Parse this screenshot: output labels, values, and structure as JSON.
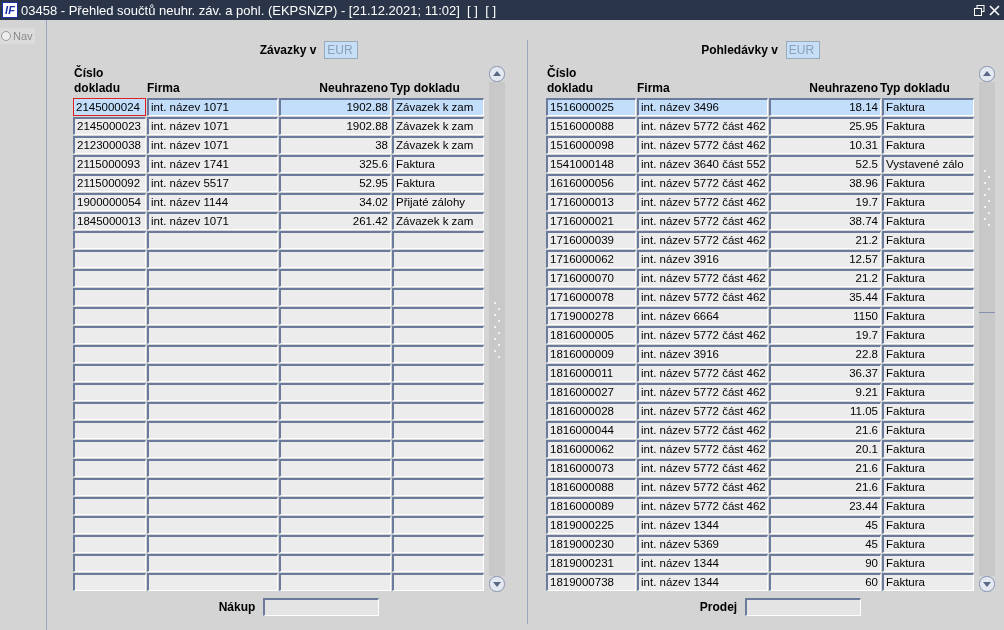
{
  "window": {
    "logo": "IF",
    "title": "03458 - Přehled součtů neuhr. záv. a pohl. (EKPSNZP) - [21.12.2021; 11:02]  [ ]  [ ]"
  },
  "nav": {
    "label": "Nav",
    "selected": false
  },
  "panels": [
    {
      "title": "Závazky v",
      "currency": "EUR",
      "columns": [
        "Číslo dokladu",
        "Firma",
        "Neuhrazeno",
        "Typ dokladu"
      ],
      "total_label": "Nákup",
      "rows": [
        {
          "number": "2145000024",
          "company": "int. název 1071",
          "amount": "1902.88",
          "type": "Závazek k zam",
          "selected": true,
          "focused": true
        },
        {
          "number": "2145000023",
          "company": "int. název 1071",
          "amount": "1902.88",
          "type": "Závazek k zam",
          "selected": false,
          "focused": false
        },
        {
          "number": "2123000038",
          "company": "int. název 1071",
          "amount": "38",
          "type": "Závazek k zam",
          "selected": false,
          "focused": false
        },
        {
          "number": "2115000093",
          "company": "int. název 1741",
          "amount": "325.6",
          "type": "Faktura",
          "selected": false,
          "focused": false
        },
        {
          "number": "2115000092",
          "company": "int. název 5517",
          "amount": "52.95",
          "type": "Faktura",
          "selected": false,
          "focused": false
        },
        {
          "number": "1900000054",
          "company": "int. název 1144",
          "amount": "34.02",
          "type": "Přijaté zálohy",
          "selected": false,
          "focused": false
        },
        {
          "number": "1845000013",
          "company": "int. název 1071",
          "amount": "261.42",
          "type": "Závazek k zam",
          "selected": false,
          "focused": false
        }
      ]
    },
    {
      "title": "Pohledávky v",
      "currency": "EUR",
      "columns": [
        "Číslo dokladu",
        "Firma",
        "Neuhrazeno",
        "Typ dokladu"
      ],
      "total_label": "Prodej",
      "rows": [
        {
          "number": "1516000025",
          "company": "int. název 3496",
          "amount": "18.14",
          "type": "Faktura",
          "selected": true,
          "focused": false
        },
        {
          "number": "1516000088",
          "company": "int. název 5772 část 462",
          "amount": "25.95",
          "type": "Faktura",
          "selected": false,
          "focused": false
        },
        {
          "number": "1516000098",
          "company": "int. název 5772 část 462",
          "amount": "10.31",
          "type": "Faktura",
          "selected": false,
          "focused": false
        },
        {
          "number": "1541000148",
          "company": "int. název 3640 část 552",
          "amount": "52.5",
          "type": "Vystavené zálo",
          "selected": false,
          "focused": false
        },
        {
          "number": "1616000056",
          "company": "int. název 5772 část 462",
          "amount": "38.96",
          "type": "Faktura",
          "selected": false,
          "focused": false
        },
        {
          "number": "1716000013",
          "company": "int. název 5772 část 462",
          "amount": "19.7",
          "type": "Faktura",
          "selected": false,
          "focused": false
        },
        {
          "number": "1716000021",
          "company": "int. název 5772 část 462",
          "amount": "38.74",
          "type": "Faktura",
          "selected": false,
          "focused": false
        },
        {
          "number": "1716000039",
          "company": "int. název 5772 část 462",
          "amount": "21.2",
          "type": "Faktura",
          "selected": false,
          "focused": false
        },
        {
          "number": "1716000062",
          "company": "int. název 3916",
          "amount": "12.57",
          "type": "Faktura",
          "selected": false,
          "focused": false
        },
        {
          "number": "1716000070",
          "company": "int. název 5772 část 462",
          "amount": "21.2",
          "type": "Faktura",
          "selected": false,
          "focused": false
        },
        {
          "number": "1716000078",
          "company": "int. název 5772 část 462",
          "amount": "35.44",
          "type": "Faktura",
          "selected": false,
          "focused": false
        },
        {
          "number": "1719000278",
          "company": "int. název 6664",
          "amount": "1150",
          "type": "Faktura",
          "selected": false,
          "focused": false
        },
        {
          "number": "1816000005",
          "company": "int. název 5772 část 462",
          "amount": "19.7",
          "type": "Faktura",
          "selected": false,
          "focused": false
        },
        {
          "number": "1816000009",
          "company": "int. název 3916",
          "amount": "22.8",
          "type": "Faktura",
          "selected": false,
          "focused": false
        },
        {
          "number": "1816000011",
          "company": "int. název 5772 část 462",
          "amount": "36.37",
          "type": "Faktura",
          "selected": false,
          "focused": false
        },
        {
          "number": "1816000027",
          "company": "int. název 5772 část 462",
          "amount": "9.21",
          "type": "Faktura",
          "selected": false,
          "focused": false
        },
        {
          "number": "1816000028",
          "company": "int. název 5772 část 462",
          "amount": "11.05",
          "type": "Faktura",
          "selected": false,
          "focused": false
        },
        {
          "number": "1816000044",
          "company": "int. název 5772 část 462",
          "amount": "21.6",
          "type": "Faktura",
          "selected": false,
          "focused": false
        },
        {
          "number": "1816000062",
          "company": "int. název 5772 část 462",
          "amount": "20.1",
          "type": "Faktura",
          "selected": false,
          "focused": false
        },
        {
          "number": "1816000073",
          "company": "int. název 5772 část 462",
          "amount": "21.6",
          "type": "Faktura",
          "selected": false,
          "focused": false
        },
        {
          "number": "1816000088",
          "company": "int. název 5772 část 462",
          "amount": "21.6",
          "type": "Faktura",
          "selected": false,
          "focused": false
        },
        {
          "number": "1816000089",
          "company": "int. název 5772 část 462",
          "amount": "23.44",
          "type": "Faktura",
          "selected": false,
          "focused": false
        },
        {
          "number": "1819000225",
          "company": "int. název 1344",
          "amount": "45",
          "type": "Faktura",
          "selected": false,
          "focused": false
        },
        {
          "number": "1819000230",
          "company": "int. název 5369",
          "amount": "45",
          "type": "Faktura",
          "selected": false,
          "focused": false
        },
        {
          "number": "1819000231",
          "company": "int. název 1344",
          "amount": "90",
          "type": "Faktura",
          "selected": false,
          "focused": false
        },
        {
          "number": "1819000738",
          "company": "int. název 1344",
          "amount": "60",
          "type": "Faktura",
          "selected": false,
          "focused": false
        }
      ]
    }
  ]
}
